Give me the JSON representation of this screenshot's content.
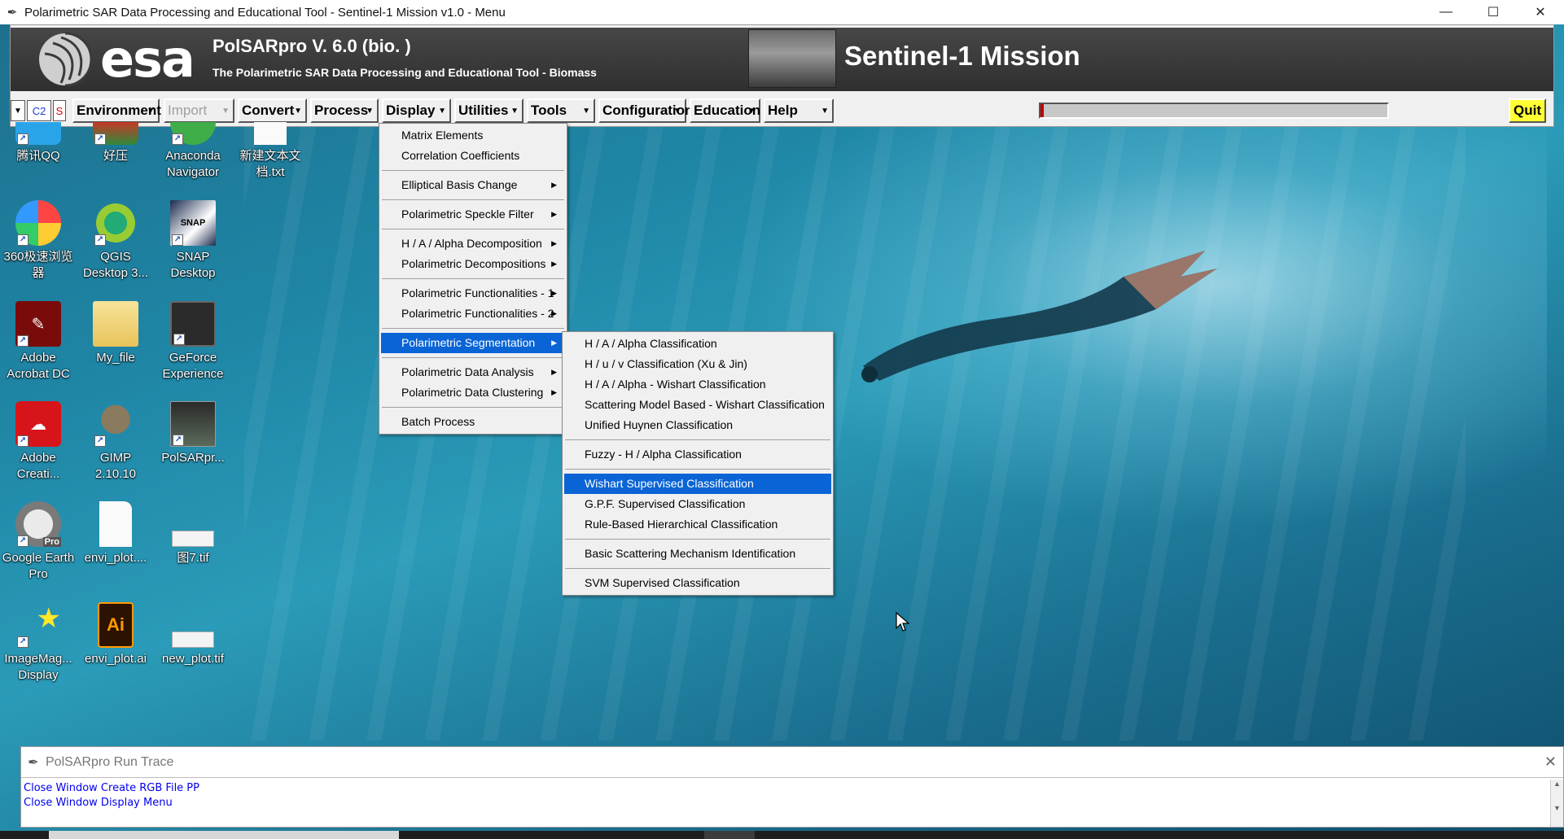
{
  "window": {
    "title": "Polarimetric SAR Data Processing and Educational Tool - Sentinel-1 Mission v1.0 - Menu",
    "controls": [
      "—",
      "☐",
      "✕"
    ]
  },
  "banner": {
    "esa_text": "esa",
    "product_title": "PolSARpro V. 6.0 (bio. )",
    "product_subtitle": "The Polarimetric SAR Data Processing and Educational Tool - Biomass",
    "mission_title": "Sentinel-1 Mission"
  },
  "toolbar": {
    "dropdown_glyph": "▼",
    "mode_field": "C2",
    "s_field": "S",
    "menus": [
      {
        "label": "Environment",
        "enabled": true
      },
      {
        "label": "Import",
        "enabled": false
      },
      {
        "label": "Convert",
        "enabled": true
      },
      {
        "label": "Process",
        "enabled": true
      },
      {
        "label": "Display",
        "enabled": true
      },
      {
        "label": "Utilities",
        "enabled": true
      },
      {
        "label": "Tools",
        "enabled": true
      },
      {
        "label": "Configuration",
        "enabled": true
      },
      {
        "label": "Education",
        "enabled": true
      },
      {
        "label": "Help",
        "enabled": true
      }
    ],
    "progress_fraction": 0.01,
    "quit_label": "Quit"
  },
  "desktop_icons": [
    {
      "label": "腾讯QQ",
      "icon": "qq-icon"
    },
    {
      "label": "好压",
      "icon": "haozip-icon"
    },
    {
      "label": "Anaconda Navigator",
      "icon": "anaconda-icon"
    },
    {
      "label": "新建文本文档.txt",
      "icon": "text-file-icon"
    },
    {
      "label": "360极速浏览器",
      "icon": "browser-360-icon"
    },
    {
      "label": "QGIS Desktop 3...",
      "icon": "qgis-icon"
    },
    {
      "label": "SNAP Desktop",
      "icon": "snap-icon",
      "glyph": "SNAP"
    },
    {
      "label": "Adobe Acrobat DC",
      "icon": "acrobat-icon"
    },
    {
      "label": "My_file",
      "icon": "folder-icon"
    },
    {
      "label": "GeForce Experience",
      "icon": "geforce-icon"
    },
    {
      "label": "Adobe Creati...",
      "icon": "creative-cloud-icon"
    },
    {
      "label": "GIMP 2.10.10",
      "icon": "gimp-icon"
    },
    {
      "label": "PolSARpr...",
      "icon": "polsarpro-icon"
    },
    {
      "label": "Google Earth Pro",
      "icon": "google-earth-icon",
      "glyph": "Pro"
    },
    {
      "label": "envi_plot....",
      "icon": "file-icon"
    },
    {
      "label": "图7.tif",
      "icon": "tif-icon"
    },
    {
      "label": "ImageMag... Display",
      "icon": "imagemagick-icon"
    },
    {
      "label": "envi_plot.ai",
      "icon": "illustrator-icon",
      "glyph": "Ai"
    },
    {
      "label": "new_plot.tif",
      "icon": "tif-icon"
    }
  ],
  "process_menu": {
    "items": [
      "Matrix Elements",
      "Correlation Coefficients",
      "Elliptical Basis Change",
      "Polarimetric Speckle Filter",
      "H / A / Alpha Decomposition",
      "Polarimetric Decompositions",
      "Polarimetric Functionalities - 1",
      "Polarimetric Functionalities - 2",
      "Polarimetric Segmentation",
      "Polarimetric Data Analysis",
      "Polarimetric Data Clustering",
      "Batch Process"
    ],
    "active": "Polarimetric Segmentation",
    "submenu_arrow": "▶"
  },
  "segmentation_menu": {
    "items": [
      "H / A / Alpha Classification",
      "H / u / v Classification (Xu & Jin)",
      "H / A / Alpha - Wishart Classification",
      "Scattering Model Based - Wishart Classification",
      "Unified Huynen Classification",
      "Fuzzy - H / Alpha Classification",
      "Wishart Supervised Classification",
      "G.P.F. Supervised Classification",
      "Rule-Based Hierarchical Classification",
      "Basic Scattering Mechanism Identification",
      "SVM Supervised Classification"
    ],
    "active": "Wishart Supervised Classification"
  },
  "run_trace": {
    "title": "PolSARpro Run Trace",
    "close_glyph": "✕",
    "lines": [
      "Close Window Create RGB File PP",
      "Close Window Display Menu"
    ]
  }
}
